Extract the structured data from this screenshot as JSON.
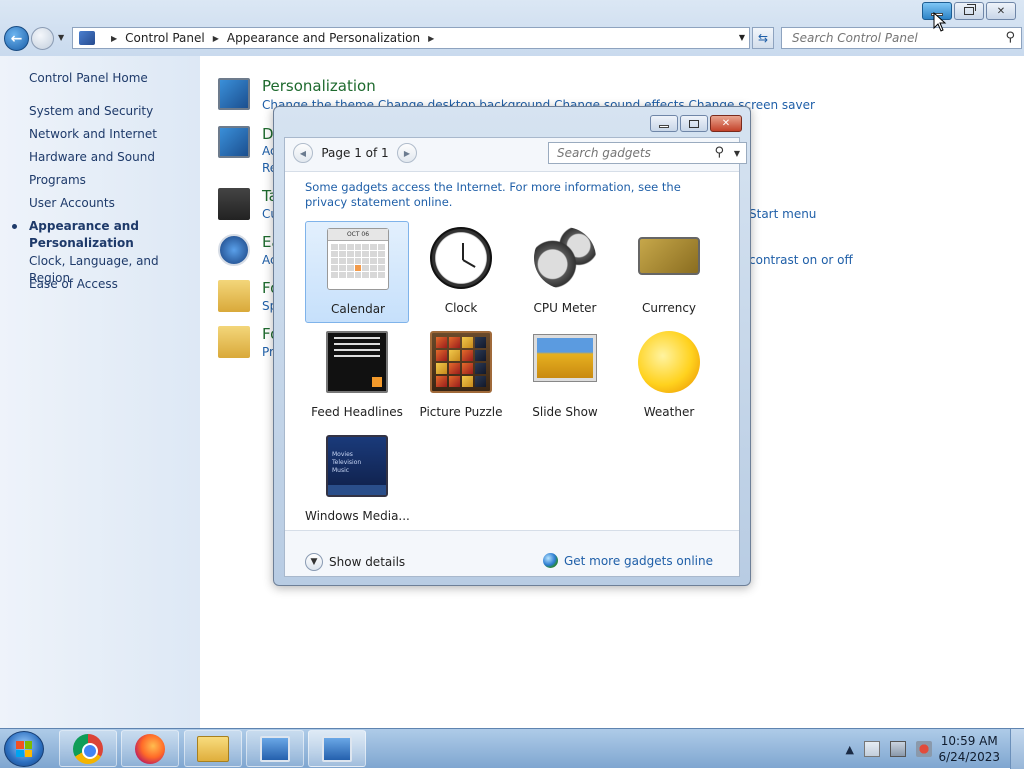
{
  "window": {
    "minimize_label": "",
    "restore_label": "",
    "close_label": "✕"
  },
  "nav": {
    "back_label": "←"
  },
  "address": {
    "crumbs": [
      "Control Panel",
      "Appearance and Personalization"
    ]
  },
  "search": {
    "placeholder": "Search Control Panel"
  },
  "sidebar": {
    "items": [
      {
        "label": "Control Panel Home"
      },
      {
        "label": "System and Security"
      },
      {
        "label": "Network and Internet"
      },
      {
        "label": "Hardware and Sound"
      },
      {
        "label": "Programs"
      },
      {
        "label": "User Accounts"
      },
      {
        "label": "Appearance and Personalization"
      },
      {
        "label": "Clock, Language, and Region"
      },
      {
        "label": "Ease of Access"
      }
    ]
  },
  "main": {
    "categories": [
      {
        "title": "Personalization",
        "links": "Change the theme    Change desktop background    Change sound effects    Change screen saver"
      },
      {
        "title": "D",
        "links": "Ac",
        "links2": "Re"
      },
      {
        "title": "Ta",
        "links": "Cu",
        "right": "Start menu"
      },
      {
        "title": "Ea",
        "links": "Ac",
        "right": "contrast on or off"
      },
      {
        "title": "Fo",
        "links": "Sp"
      },
      {
        "title": "Fo",
        "links": "Pr"
      }
    ]
  },
  "dialog": {
    "page_label": "Page 1 of 1",
    "search_placeholder": "Search gadgets",
    "info_text": "Some gadgets access the Internet.  For more information, see the privacy statement online.",
    "gadgets": [
      {
        "label": "Calendar",
        "icon": "calendar-icon",
        "selected": true
      },
      {
        "label": "Clock",
        "icon": "clock-icon"
      },
      {
        "label": "CPU Meter",
        "icon": "cpu-meter-icon"
      },
      {
        "label": "Currency",
        "icon": "currency-icon"
      },
      {
        "label": "Feed Headlines",
        "icon": "feed-headlines-icon"
      },
      {
        "label": "Picture Puzzle",
        "icon": "picture-puzzle-icon"
      },
      {
        "label": "Slide Show",
        "icon": "slide-show-icon"
      },
      {
        "label": "Weather",
        "icon": "weather-icon"
      },
      {
        "label": "Windows Media...",
        "icon": "windows-media-icon"
      }
    ],
    "calendar_month": "OCT 06",
    "wmc_lines": [
      "Movies",
      "Television",
      "Music"
    ],
    "show_details": "Show details",
    "get_more": "Get more gadgets online"
  },
  "taskbar": {
    "time": "10:59 AM",
    "date": "6/24/2023",
    "tray_expand": "▲"
  },
  "colors": {
    "link_blue": "#1f5fa8",
    "category_green": "#1e6a2e",
    "taskbar": "#7fa6d0"
  }
}
